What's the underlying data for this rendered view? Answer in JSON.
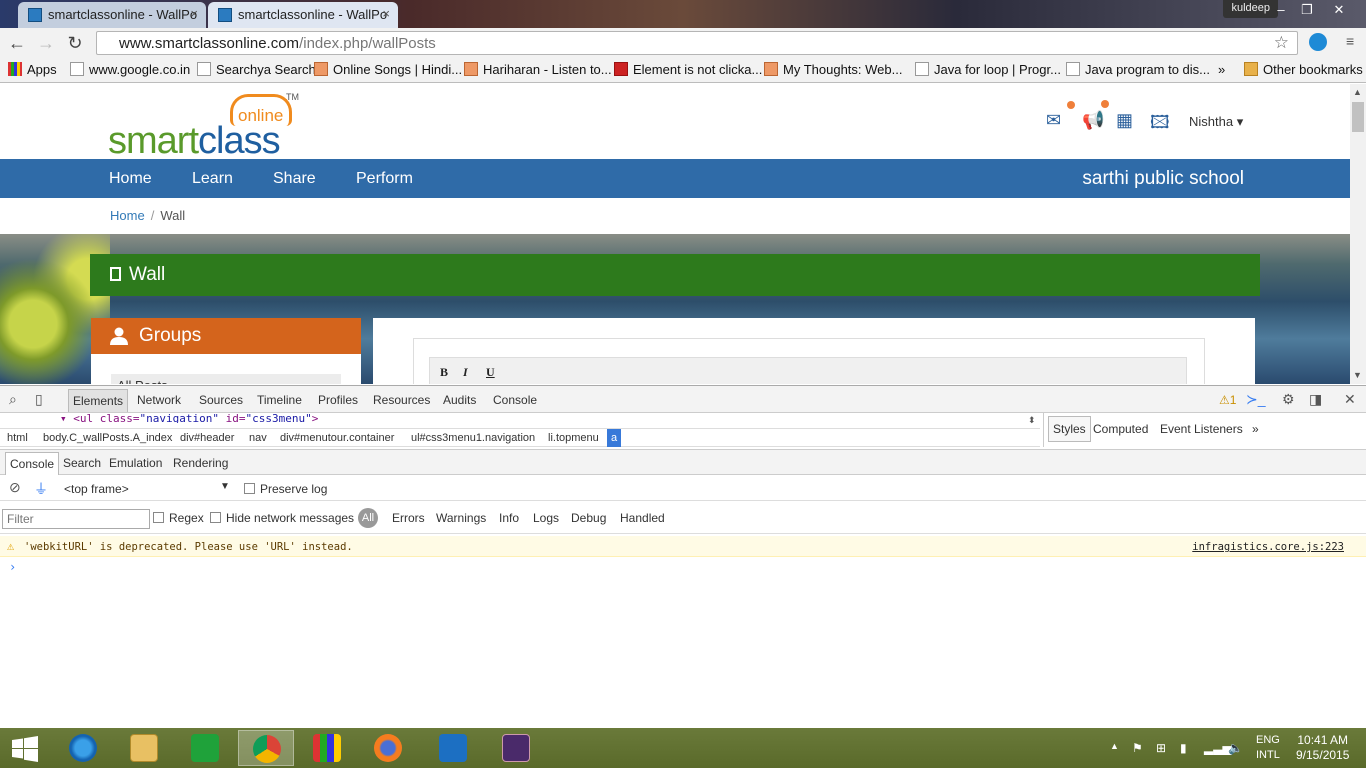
{
  "browser": {
    "tabs": [
      {
        "title": "smartclassonline - WallPo",
        "active": false
      },
      {
        "title": "smartclassonline - WallPo",
        "active": true
      }
    ],
    "window_user": "kuldeep",
    "address": {
      "host": "www.smartclassonline.com",
      "path": "/index.php/wallPosts"
    },
    "bookmarks": [
      {
        "label": "Apps",
        "icon": "apps-icon"
      },
      {
        "label": "www.google.co.in",
        "icon": "page-icon"
      },
      {
        "label": "Searchya Search",
        "icon": "page-icon"
      },
      {
        "label": "Online Songs | Hindi...",
        "icon": "music-icon"
      },
      {
        "label": "Hariharan - Listen to...",
        "icon": "music-icon"
      },
      {
        "label": "Element is not clicka...",
        "icon": "stackoverflow-icon"
      },
      {
        "label": "My Thoughts: Web...",
        "icon": "blog-icon"
      },
      {
        "label": "Java for loop | Progr...",
        "icon": "page-icon"
      },
      {
        "label": "Java program to dis...",
        "icon": "page-icon"
      }
    ],
    "bookmarks_overflow": "»",
    "other_bookmarks": "Other bookmarks"
  },
  "site": {
    "logo": {
      "word1": "smart",
      "word2": "class",
      "cloud_text": "online",
      "tm": "TM"
    },
    "header_icons": [
      "mail-icon",
      "megaphone-icon",
      "calendar-icon",
      "gallery-icon"
    ],
    "user": "Nishtha",
    "nav": [
      "Home",
      "Learn",
      "Share",
      "Perform"
    ],
    "school": "sarthi public school",
    "breadcrumb": {
      "home": "Home",
      "separator": "/",
      "current": "Wall"
    },
    "wall_title": "Wall",
    "groups_title": "Groups",
    "groups_first_item": "All Posts",
    "composer_buttons": [
      "B",
      "I",
      "U"
    ],
    "colors": {
      "nav": "#2f6ba8",
      "wall": "#2d7a1c",
      "groups": "#d4641c",
      "logo_green": "#5a9a2b",
      "logo_orange": "#f08b1e"
    }
  },
  "devtools": {
    "tabs": [
      "Elements",
      "Network",
      "Sources",
      "Timeline",
      "Profiles",
      "Resources",
      "Audits",
      "Console"
    ],
    "selected_tab": "Elements",
    "warning_count": "1",
    "code_line": {
      "tag_open": "<ul class=",
      "class_val": "\"navigation\"",
      "id_attr": " id=",
      "id_val": "\"css3menu\"",
      "tag_close": ">"
    },
    "breadcrumbs": [
      "html",
      "body.C_wallPosts.A_index",
      "div#header",
      "nav",
      "div#menutour.container",
      "ul#css3menu1.navigation",
      "li.topmenu",
      "a"
    ],
    "side_tabs": [
      "Styles",
      "Computed",
      "Event Listeners"
    ],
    "side_overflow": "»",
    "drawer_tabs": [
      "Console",
      "Search",
      "Emulation",
      "Rendering"
    ],
    "frame_select": "<top frame>",
    "preserve_log": "Preserve log",
    "filter_placeholder": "Filter",
    "regex": "Regex",
    "hide_network": "Hide network messages",
    "levels": [
      "All",
      "Errors",
      "Warnings",
      "Info",
      "Logs",
      "Debug",
      "Handled"
    ],
    "warning": {
      "message": "'webkitURL' is deprecated. Please use 'URL' instead.",
      "source": "infragistics.core.js:223"
    },
    "prompt": "›"
  },
  "taskbar": {
    "apps": [
      "windows-start-icon",
      "internet-explorer-icon",
      "file-explorer-icon",
      "store-icon",
      "chrome-icon",
      "apps-grid-icon",
      "firefox-icon",
      "outlook-icon",
      "java-ee-ide-icon"
    ],
    "lang": {
      "line1": "ENG",
      "line2": "INTL"
    },
    "time": "10:41 AM",
    "date": "9/15/2015"
  }
}
